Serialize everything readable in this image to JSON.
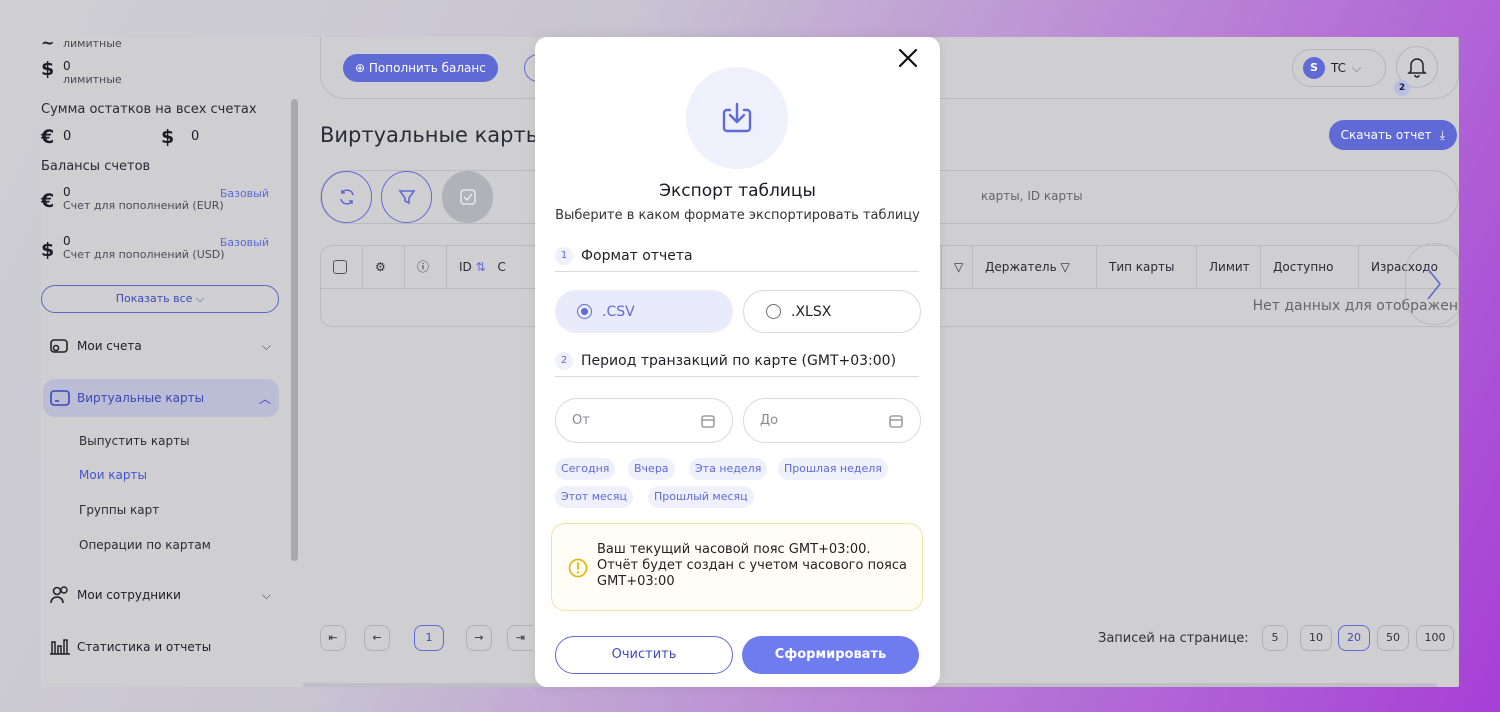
{
  "sidebar": {
    "balances": [
      {
        "currency": "$",
        "value": "0",
        "sub": "лимитные"
      }
    ],
    "top_cut_label": "лимитные",
    "total_title": "Сумма остатков на всех счетах",
    "total_eur": {
      "currency": "€",
      "value": "0"
    },
    "total_usd": {
      "currency": "$",
      "value": "0"
    },
    "accounts_title": "Балансы счетов",
    "accounts": [
      {
        "currency": "€",
        "value": "0",
        "name": "Счет для пополнений (EUR)",
        "tag": "Базовый"
      },
      {
        "currency": "$",
        "value": "0",
        "name": "Счет для пополнений (USD)",
        "tag": "Базовый"
      }
    ],
    "show_all": "Показать все",
    "nav": [
      {
        "label": "Мои счета"
      },
      {
        "label": "Виртуальные карты"
      },
      {
        "label": "Мои сотрудники"
      },
      {
        "label": "Статистика и отчеты"
      }
    ],
    "sub_items": [
      "Выпустить карты",
      "Мои карты",
      "Группы карт",
      "Операции по картам"
    ]
  },
  "topbar": {
    "topup_label": "Пополнить баланс",
    "user_avatar": "S",
    "user_name": "TC",
    "bell_count": "2"
  },
  "page": {
    "title": "Виртуальные карты",
    "download_label": "Скачать отчет",
    "search_placeholder_tail": "карты, ID карты"
  },
  "table": {
    "headers": [
      "ID",
      "Держатель",
      "Тип карты",
      "Лимит",
      "Доступно",
      "Израсходо"
    ],
    "header_cut": "С",
    "empty": "Нет данных для отображен"
  },
  "pagination": {
    "current": "1",
    "per_page_label": "Записей на странице:",
    "sizes": [
      "5",
      "10",
      "20",
      "50",
      "100"
    ],
    "active_size": "20"
  },
  "modal": {
    "title": "Экспорт таблицы",
    "subtitle": "Выберите в каком формате экспортировать таблицу",
    "step1": {
      "num": "1",
      "label": "Формат отчета"
    },
    "formats": [
      ".CSV",
      ".XLSX"
    ],
    "step2": {
      "num": "2",
      "label": "Период транзакций по карте (GMT+03:00)"
    },
    "from_placeholder": "От",
    "to_placeholder": "До",
    "chips": [
      "Сегодня",
      "Вчера",
      "Эта неделя",
      "Прошлая неделя",
      "Этот месяц",
      "Прошлый месяц"
    ],
    "warning": "Ваш текущий часовой пояс GMT+03:00. Отчёт будет создан с учетом часового пояса GMT+03:00",
    "clear_label": "Очистить",
    "submit_label": "Сформировать"
  },
  "colors": {
    "accent": "#5f6ad7",
    "button": "#6f7cf0",
    "warning_border": "#f1e3a6"
  }
}
